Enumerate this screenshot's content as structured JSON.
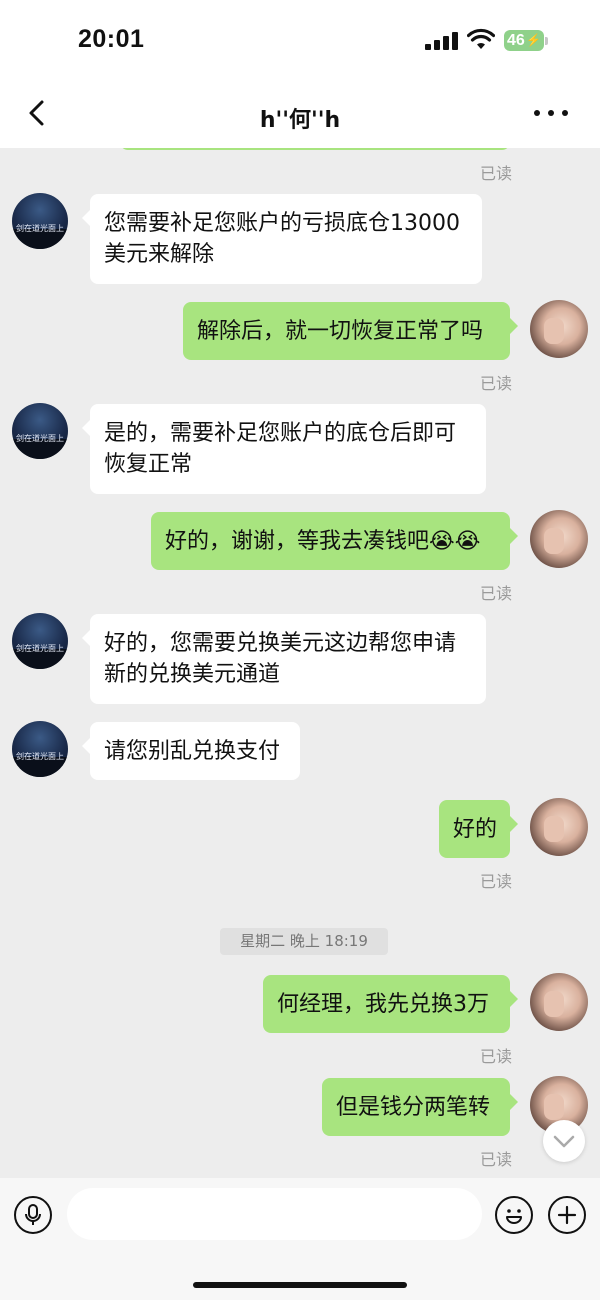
{
  "status": {
    "time": "20:01",
    "battery": "46"
  },
  "header": {
    "title": "h''何''h"
  },
  "messages": [
    {
      "from": "me",
      "lines": [
        ""
      ],
      "read": "已读"
    },
    {
      "from": "other",
      "lines": [
        "您需要补足您账户的亏损底仓13000",
        "美元来解除"
      ]
    },
    {
      "from": "me",
      "lines": [
        "解除后，就一切恢复正常了吗"
      ],
      "read": "已读"
    },
    {
      "from": "other",
      "lines": [
        "是的，需要补足您账户的底仓后即可",
        "恢复正常"
      ]
    },
    {
      "from": "me",
      "lines": [
        "好的，谢谢，等我去凑钱吧😭😭"
      ],
      "read": "已读"
    },
    {
      "from": "other",
      "lines": [
        "好的，您需要兑换美元这边帮您申请",
        "新的兑换美元通道"
      ]
    },
    {
      "from": "other",
      "lines": [
        "请您别乱兑换支付"
      ]
    },
    {
      "from": "me",
      "lines": [
        "好的"
      ],
      "read": "已读"
    },
    {
      "from": "me",
      "lines": [
        "何经理，我先兑换3万"
      ],
      "read": "已读"
    },
    {
      "from": "me",
      "lines": [
        "但是钱分两笔转"
      ],
      "read": "已读"
    }
  ],
  "timestamp_divider": "星期二 晚上 18:19",
  "avatar_caption": "剑在道光面上",
  "input": {
    "placeholder": ""
  },
  "icons": {
    "back": "chevron-left-icon",
    "more": "ellipsis-icon",
    "voice": "microphone-icon",
    "emoji": "smiley-icon",
    "add": "plus-circle-icon",
    "scroll": "chevron-down-icon"
  },
  "colors": {
    "outgoing_bubble": "#a8e47f",
    "incoming_bubble": "#ffffff",
    "background": "#ededed"
  }
}
